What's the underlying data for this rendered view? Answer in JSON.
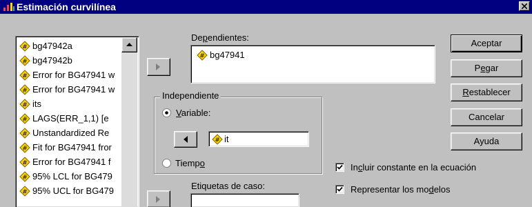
{
  "window": {
    "title": "Estimación curvilínea"
  },
  "variables": [
    "bg47942a",
    "bg47942b",
    "Error for BG47941 w",
    "Error for BG47941 w",
    "its",
    "LAGS(ERR_1,1) [e",
    "Unstandardized Re",
    "Fit for BG47941 fror",
    "Error for BG47941 f",
    "95% LCL for BG479",
    "95% UCL for BG479"
  ],
  "dependientes": {
    "label": "Dependientes:",
    "items": [
      "bg47941"
    ]
  },
  "independiente": {
    "group_label": "Independiente",
    "variable_option": "Variable:",
    "variable_value": "it",
    "tiempo_option": "Tiempo",
    "selected": "variable"
  },
  "etiquetas": {
    "label": "Etiquetas de caso:"
  },
  "checkboxes": {
    "include_constant": {
      "label": "Incluir constante en la ecuación",
      "checked": true
    },
    "plot_models": {
      "label": "Representar los modelos",
      "checked": true
    }
  },
  "buttons": {
    "aceptar": "Aceptar",
    "pegar": "Pegar",
    "restablecer": "Restablecer",
    "cancelar": "Cancelar",
    "ayuda": "Ayuda"
  },
  "icons": {
    "variable": "numeric-variable-icon",
    "app": "spss-app-icon",
    "close": "close-icon"
  },
  "colors": {
    "titlebar": "#000080",
    "dialog": "#c0c0c0",
    "variable_icon": "#ffd700"
  }
}
